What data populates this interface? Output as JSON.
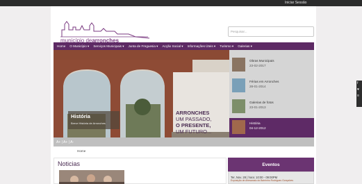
{
  "topbar": {
    "login_label": "Iniciar Sessão"
  },
  "header": {
    "logo_prefix": "município de",
    "logo_name": "arronches",
    "search_placeholder": "Pesquisar..."
  },
  "nav": {
    "items": [
      {
        "label": "Home"
      },
      {
        "label": "O Município ▾"
      },
      {
        "label": "Serviços Municipais ▾"
      },
      {
        "label": "Junta de Freguesia ▾"
      },
      {
        "label": "Acção Social ▾"
      },
      {
        "label": "Informações Úteis ▾"
      },
      {
        "label": "Turismo ▾"
      },
      {
        "label": "Galerias ▾"
      }
    ]
  },
  "hero": {
    "caption_title": "História",
    "caption_subtitle": "Breve História de Arronches",
    "slogan": {
      "line1": "ARRONCHES",
      "line2": "UM PASSADO,",
      "line3": "O PRESENTE,",
      "line4": "UM FUTURO..."
    }
  },
  "slides": [
    {
      "title": "Obras Municipais",
      "date": "23-02-2017"
    },
    {
      "title": "Férias em Arronches",
      "date": "28-01-2014"
    },
    {
      "title": "Galerias de fotos",
      "date": "23-01-2013"
    },
    {
      "title": "História",
      "date": "04-12-2012"
    }
  ],
  "font_controls": {
    "label": "A+ | A+ | A-"
  },
  "breadcrumb": {
    "home": "Home"
  },
  "news": {
    "title": "Noticias"
  },
  "events": {
    "title": "Eventos",
    "item_date": "Ter, Nov. 28 | hora: 10:00 - 09:00PM",
    "item_desc": "Exposição de Artesanato do Bairrinho Rodrigues Gonçalves"
  },
  "colors": {
    "brand_purple": "#5d2a64",
    "active_slide": "#5e2a66",
    "topbar": "#2b2b2b"
  }
}
